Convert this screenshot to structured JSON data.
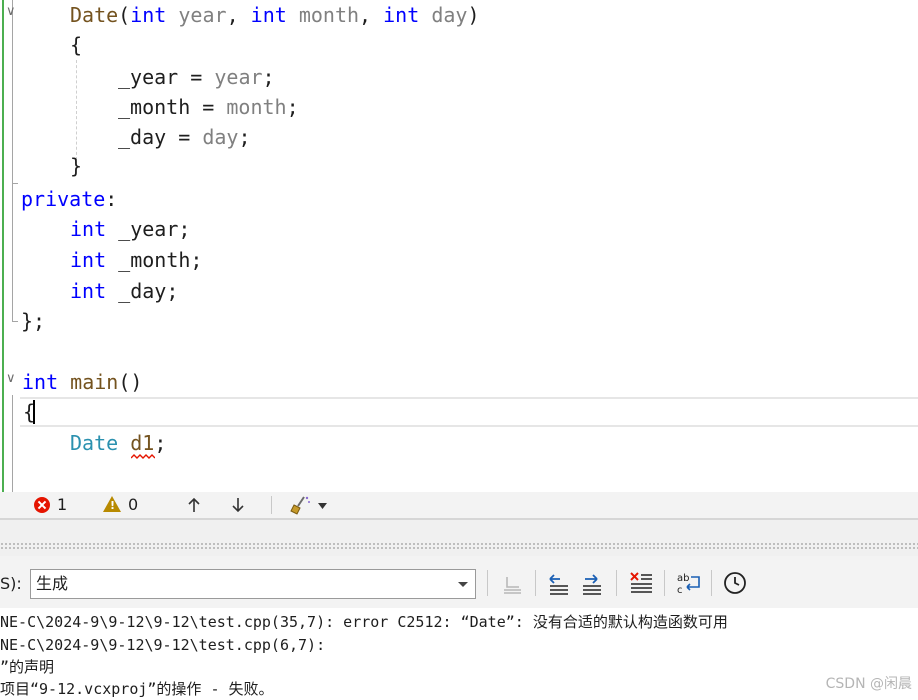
{
  "editor": {
    "code": {
      "ctor": {
        "name": "Date",
        "open": "(",
        "t1": "int",
        "p1": "year",
        "c1": ",",
        "t2": "int",
        "p2": "month",
        "c2": ",",
        "t3": "int",
        "p3": "day",
        "close": ")"
      },
      "brace_open_1": "{",
      "assign1": {
        "lhs": "_year",
        "eq": "=",
        "rhs": "year",
        "semi": ";"
      },
      "assign2": {
        "lhs": "_month",
        "eq": "=",
        "rhs": "month",
        "semi": ";"
      },
      "assign3": {
        "lhs": "_day",
        "eq": "=",
        "rhs": "day",
        "semi": ";"
      },
      "brace_close_1": "}",
      "private": {
        "kw": "private",
        "colon": ":"
      },
      "field1": {
        "type": "int",
        "name": "_year;"
      },
      "field2": {
        "type": "int",
        "name": "_month;"
      },
      "field3": {
        "type": "int",
        "name": "_day;"
      },
      "class_end": {
        "brace": "}",
        "semi": ";"
      },
      "main": {
        "type": "int",
        "name": "main",
        "parens": "()"
      },
      "brace_open_2": "{",
      "decl": {
        "type": "Date",
        "var": "d1",
        "semi": ";"
      }
    }
  },
  "status": {
    "error_count": "1",
    "warning_count": "0"
  },
  "output_pane": {
    "label": "S):",
    "source": "生成",
    "lines": [
      "NE-C\\2024-9\\9-12\\9-12\\test.cpp(35,7): error C2512: “Date”: 没有合适的默认构造函数可用",
      "NE-C\\2024-9\\9-12\\9-12\\test.cpp(6,7):",
      "”的声明",
      "项目“9-12.vcxproj”的操作 - 失败。"
    ]
  },
  "watermark": "CSDN @闲晨",
  "colors": {
    "keyword": "#0000ff",
    "type": "#2b91af",
    "function": "#74531f",
    "parameter": "#808080",
    "error": "#e51400",
    "warning": "#b88a00"
  }
}
